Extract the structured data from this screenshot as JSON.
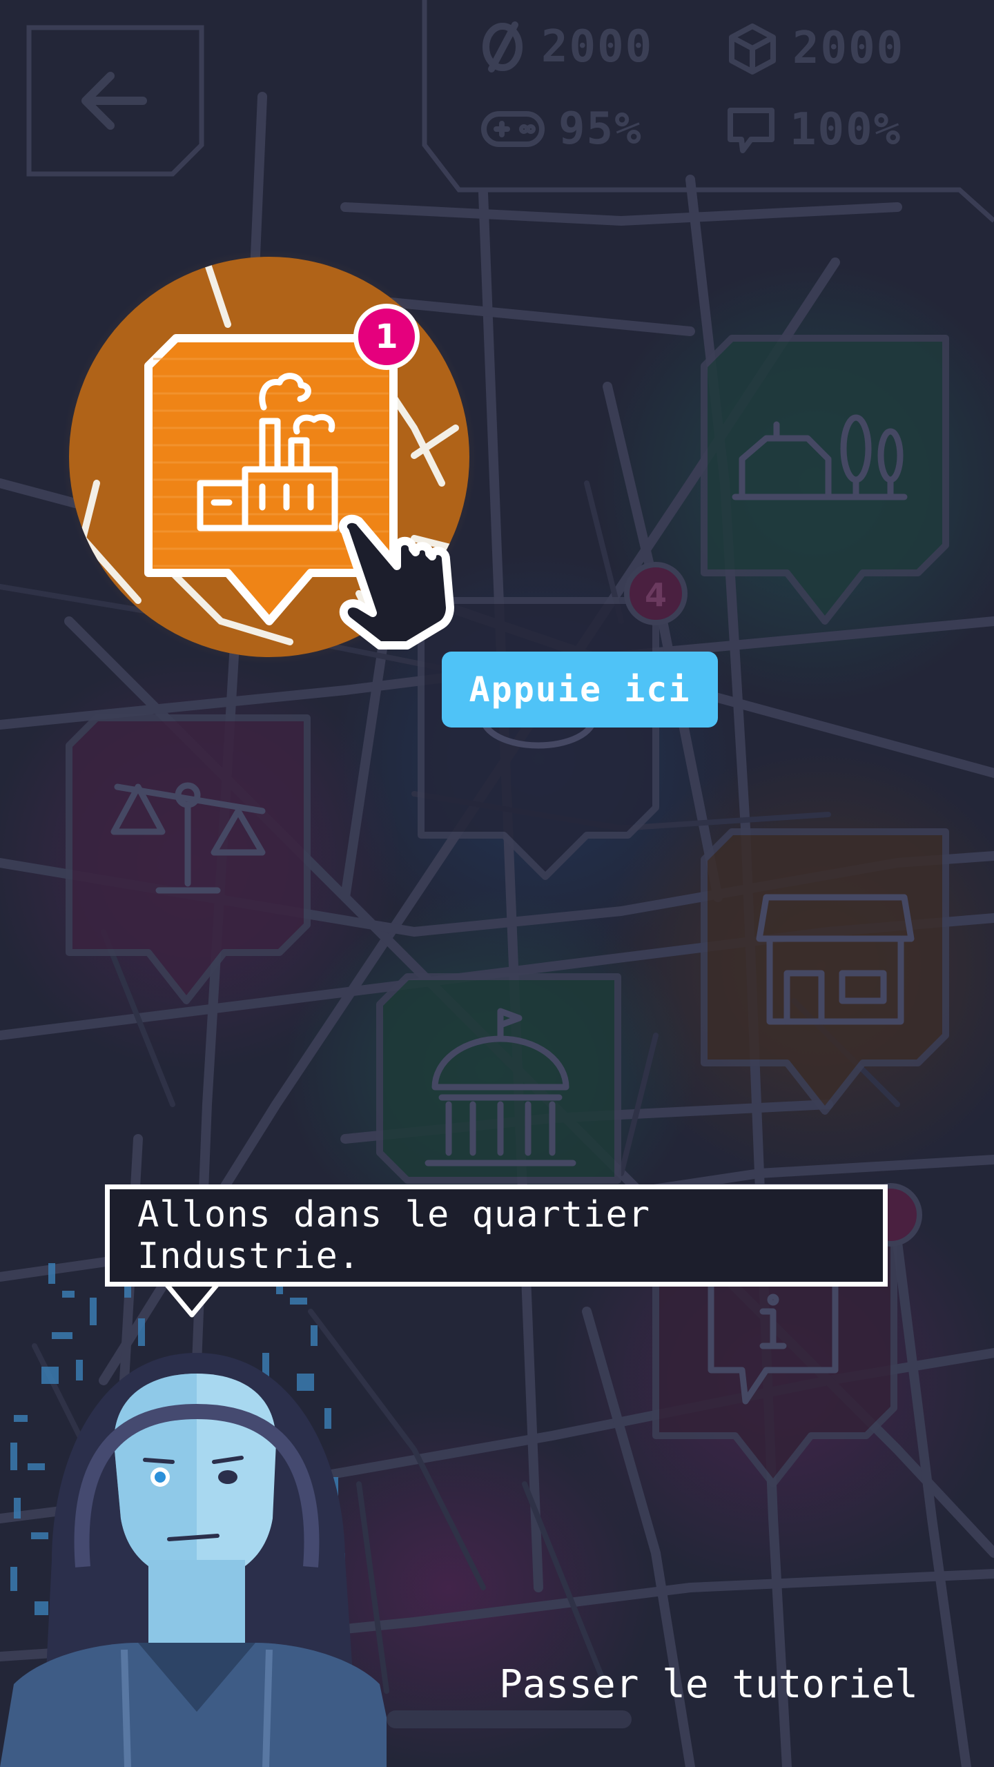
{
  "header": {
    "back_icon": "back-arrow-icon",
    "stats": [
      {
        "icon": "currency-icon",
        "value": "2000"
      },
      {
        "icon": "cube-icon",
        "value": "2000"
      },
      {
        "icon": "gamepad-icon",
        "value": "95%"
      },
      {
        "icon": "chat-icon",
        "value": "100%"
      }
    ]
  },
  "map": {
    "districts": [
      {
        "name": "industrie",
        "icon": "factory-icon",
        "badge": "1",
        "color": "#f28a1a"
      },
      {
        "name": "quartier-vert",
        "icon": "house-trees-icon",
        "color": "#1f5a4e"
      },
      {
        "name": "quartier-4",
        "icon": "unknown-icon",
        "badge": "4",
        "color": "#2a2c3f"
      },
      {
        "name": "justice",
        "icon": "scales-icon",
        "color": "#5a2550"
      },
      {
        "name": "commerce",
        "icon": "shop-icon",
        "color": "#5a3a25"
      },
      {
        "name": "mairie",
        "icon": "capitol-icon",
        "color": "#1f4a42"
      },
      {
        "name": "information",
        "icon": "info-icon",
        "color": "#4a2540"
      }
    ]
  },
  "tutorial": {
    "cta_label": "Appuie ici",
    "bubble_text": "Allons dans le quartier Industrie.",
    "skip_label": "Passer le tutoriel",
    "pointer_icon": "hand-pointer-icon",
    "avatar_icon": "hacker-avatar-icon"
  },
  "colors": {
    "background": "#232638",
    "accent_orange": "#f28a1a",
    "badge_pink": "#e5007d",
    "cta_blue": "#4fc3f7"
  }
}
